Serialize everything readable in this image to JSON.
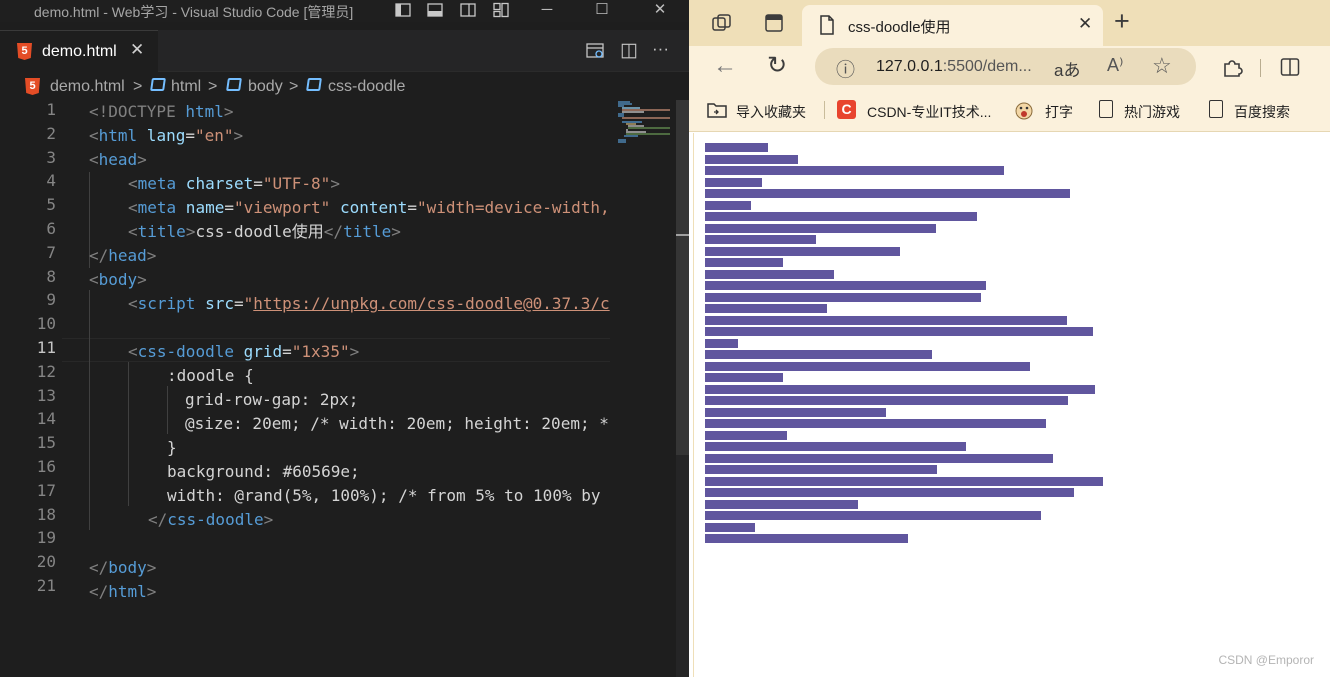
{
  "vscode": {
    "window_title": "demo.html - Web学习 - Visual Studio Code [管理员]",
    "window_controls": {
      "minimize": "─",
      "maximize": "☐",
      "close": "✕"
    },
    "tab": {
      "label": "demo.html",
      "close": "✕",
      "icon": "5"
    },
    "tab_actions": {
      "split_editor": "◫",
      "more": "···"
    },
    "breadcrumb": {
      "file": "demo.html",
      "sep": ">",
      "items": [
        "html",
        "body",
        "css-doodle"
      ]
    },
    "active_line": 11,
    "line_numbers": [
      "1",
      "2",
      "3",
      "4",
      "5",
      "6",
      "7",
      "8",
      "9",
      "10",
      "11",
      "12",
      "13",
      "14",
      "15",
      "16",
      "17",
      "18",
      "19",
      "20",
      "21"
    ],
    "code": {
      "l1": {
        "open": "<!DOCTYPE ",
        "kw": "html",
        "close": ">"
      },
      "l2": {
        "lt": "<",
        "tag": "html",
        "attr": " lang",
        "eq": "=",
        "val": "\"en\"",
        "gt": ">"
      },
      "l3": {
        "lt": "<",
        "tag": "head",
        "gt": ">"
      },
      "l4": {
        "lt": "<",
        "tag": "meta",
        "attr": " charset",
        "eq": "=",
        "val": "\"UTF-8\"",
        "gt": ">"
      },
      "l5": {
        "lt": "<",
        "tag": "meta",
        "attr1": " name",
        "eq1": "=",
        "val1": "\"viewport\"",
        "attr2": " content",
        "eq2": "=",
        "val2": "\"width=device-width,"
      },
      "l6": {
        "lt": "<",
        "tag": "title",
        "gt": ">",
        "text": "css-doodle使用",
        "lt2": "</",
        "tag2": "title",
        "gt2": ">"
      },
      "l7": {
        "lt": "</",
        "tag": "head",
        "gt": ">"
      },
      "l8": {
        "lt": "<",
        "tag": "body",
        "gt": ">"
      },
      "l9": {
        "lt": "<",
        "tag": "script",
        "attr": " src",
        "eq": "=",
        "q": "\"",
        "url": "https://unpkg.com/css-doodle@0.37.3/c"
      },
      "l11": {
        "lt": "<",
        "tag": "css-doodle",
        "attr": " grid",
        "eq": "=",
        "val": "\"1x35\"",
        "gt": ">"
      },
      "l12": {
        "sel": ":doodle",
        "brace": " {"
      },
      "l13": {
        "text": "grid-row-gap: 2px;"
      },
      "l14": {
        "text": "@size: 20em; ",
        "comment": "/* width: 20em; height: 20em; *"
      },
      "l15": {
        "text": "}"
      },
      "l16": {
        "text": "background: #60569e;"
      },
      "l17": {
        "text": "width: @rand(5%, 100%); ",
        "comment": "/* from 5% to 100% by"
      },
      "l18": {
        "lt": "</",
        "tag": "css-doodle",
        "gt": ">"
      },
      "l20": {
        "lt": "</",
        "tag": "body",
        "gt": ">"
      },
      "l21": {
        "lt": "</",
        "tag": "html",
        "gt": ">"
      }
    }
  },
  "browser": {
    "tab_title": "css-doodle使用",
    "tab_close": "✕",
    "new_tab": "+",
    "address": {
      "host": "127.0.0.1",
      "rest": ":5500/dem...",
      "read_aloud": "aあ",
      "translate": "A⁾"
    },
    "nav": {
      "back": "←",
      "refresh": "↻",
      "info": "ⓘ",
      "favorite": "☆"
    },
    "favorites": [
      {
        "label": "导入收藏夹"
      },
      {
        "label": "CSDN-专业IT技术..."
      },
      {
        "label": "打字"
      },
      {
        "label": "热门游戏"
      },
      {
        "label": "百度搜索"
      }
    ],
    "bar_color": "#60569e",
    "bar_widths_percent": [
      15.8,
      23.3,
      75.0,
      14.3,
      91.6,
      11.5,
      68.3,
      58.0,
      27.8,
      48.9,
      19.7,
      32.3,
      70.5,
      69.4,
      30.6,
      90.9,
      97.4,
      8.3,
      57.0,
      81.6,
      19.5,
      98.0,
      91.1,
      45.4,
      85.6,
      20.6,
      65.6,
      87.4,
      58.3,
      100.0,
      92.6,
      38.4,
      84.4,
      12.6,
      51.0
    ],
    "watermark": "CSDN @Emporor"
  }
}
